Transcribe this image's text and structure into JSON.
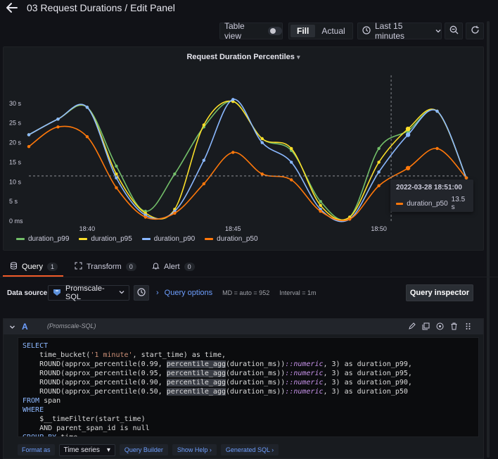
{
  "header": {
    "title": "03 Request Durations / Edit Panel"
  },
  "toolbar": {
    "table_view": "Table view",
    "fill": "Fill",
    "actual": "Actual",
    "time_range": "Last 15 minutes"
  },
  "panel": {
    "title": "Request Duration Percentiles",
    "tooltip": {
      "time": "2022-03-28 18:51:00",
      "series": "duration_p50",
      "value": "13.5 s"
    }
  },
  "chart_data": {
    "type": "line",
    "title": "Request Duration Percentiles",
    "y_ticks": [
      "30 s",
      "25 s",
      "20 s",
      "15 s",
      "10 s",
      "5 s",
      "0 ms"
    ],
    "x_ticks": [
      "18:40",
      "18:45",
      "18:50"
    ],
    "ylim": [
      0,
      35
    ],
    "y_unit": "s",
    "x": [
      "18:38",
      "18:39",
      "18:40",
      "18:41",
      "18:42",
      "18:43",
      "18:44",
      "18:45",
      "18:46",
      "18:47",
      "18:48",
      "18:49",
      "18:50",
      "18:51",
      "18:52",
      "18:53"
    ],
    "series": [
      {
        "name": "duration_p99",
        "color": "#73bf69",
        "values": [
          22,
          26,
          29,
          14,
          2.5,
          12,
          24,
          30.5,
          21,
          18,
          5,
          1,
          18.5,
          23,
          28,
          11
        ]
      },
      {
        "name": "duration_p95",
        "color": "#fade2a",
        "values": [
          22,
          26,
          29,
          12,
          2,
          3,
          24.5,
          30.5,
          21,
          18.5,
          4,
          1,
          15,
          23.5,
          28,
          11
        ]
      },
      {
        "name": "duration_p90",
        "color": "#8ab8ff",
        "values": [
          22,
          26,
          29,
          11,
          1.5,
          2.5,
          15.5,
          31,
          20,
          15,
          3,
          0.5,
          12.5,
          22,
          28,
          11
        ]
      },
      {
        "name": "duration_p50",
        "color": "#ff780a",
        "values": [
          19,
          24,
          21.5,
          8.5,
          1,
          2,
          9.5,
          17.5,
          12,
          10.5,
          2.5,
          0.5,
          9,
          13.5,
          18.5,
          11
        ]
      }
    ],
    "crosshair": {
      "x": "18:51",
      "y": 11.5
    },
    "legend_position": "bottom-left",
    "grid": false
  },
  "tabs": [
    {
      "label": "Query",
      "count": "1"
    },
    {
      "label": "Transform",
      "count": "0"
    },
    {
      "label": "Alert",
      "count": "0"
    }
  ],
  "datasource": {
    "label": "Data source",
    "name": "Promscale-SQL",
    "query_options": "Query options",
    "md": "MD = auto = 952",
    "interval": "Interval = 1m",
    "inspector": "Query inspector"
  },
  "query": {
    "ref_id": "A",
    "ds_name": "(Promscale-SQL)",
    "sql_lines": [
      {
        "kw": "SELECT",
        "rest": ""
      },
      {
        "kw": "",
        "rest": "    time_bucket('1 minute', start_time) as time,"
      },
      {
        "kw": "",
        "rest": "    ROUND(approx_percentile(0.99, percentile_agg(duration_ms))::numeric, 3) as duration_p99,"
      },
      {
        "kw": "",
        "rest": "    ROUND(approx_percentile(0.95, percentile_agg(duration_ms))::numeric, 3) as duration_p95,"
      },
      {
        "kw": "",
        "rest": "    ROUND(approx_percentile(0.90, percentile_agg(duration_ms))::numeric, 3) as duration_p90,"
      },
      {
        "kw": "",
        "rest": "    ROUND(approx_percentile(0.50, percentile_agg(duration_ms))::numeric, 3) as duration_p50"
      },
      {
        "kw": "FROM",
        "rest": " span"
      },
      {
        "kw": "WHERE",
        "rest": ""
      },
      {
        "kw": "",
        "rest": "    $__timeFilter(start_time)"
      },
      {
        "kw": "",
        "rest": "    AND parent_span_id is null"
      },
      {
        "kw": "GROUP BY",
        "rest": " time"
      }
    ],
    "format_as": "Format as",
    "format_value": "Time series",
    "query_builder": "Query Builder",
    "show_help": "Show Help",
    "generated_sql": "Generated SQL"
  }
}
